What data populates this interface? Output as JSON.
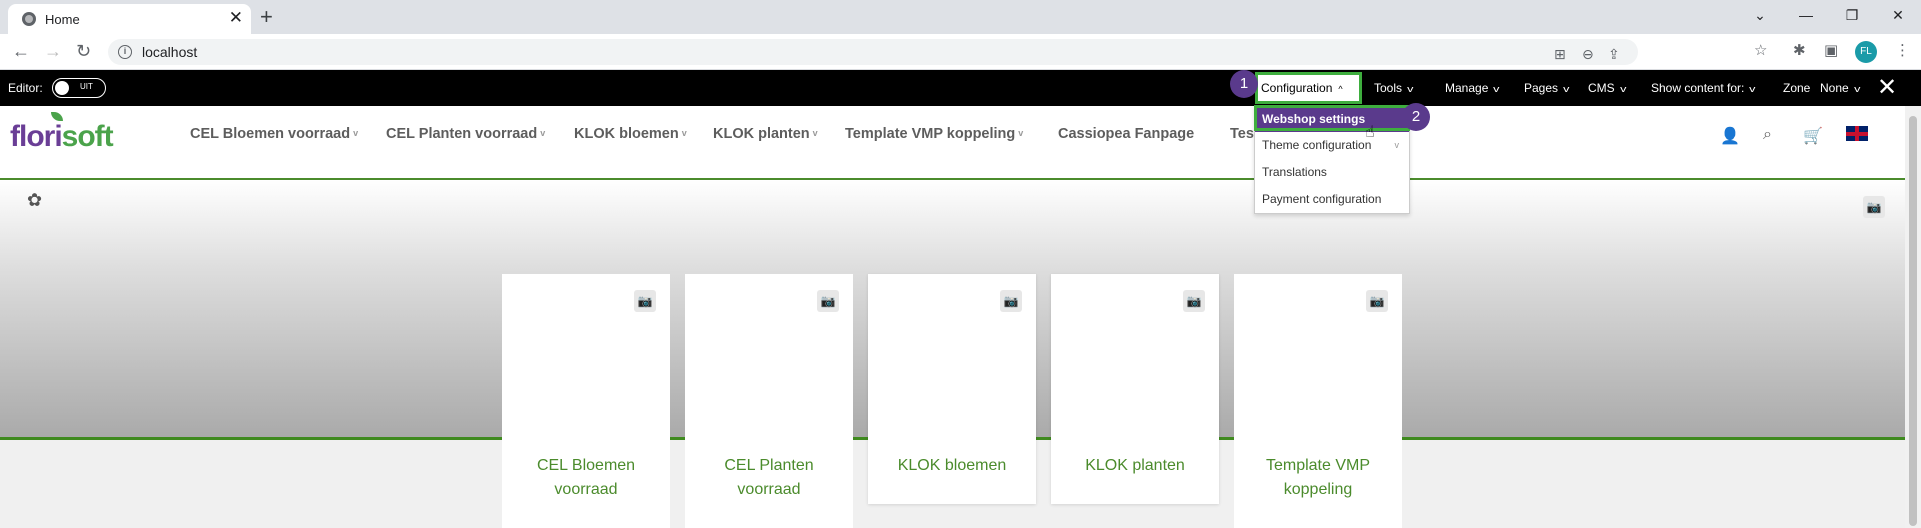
{
  "browser": {
    "tab_title": "Home",
    "tab_close": "✕",
    "new_tab": "+",
    "url": "localhost",
    "profile_initials": "FL",
    "window_controls": [
      "⌄",
      "—",
      "❐",
      "✕"
    ]
  },
  "editor_bar": {
    "editor_label": "Editor:",
    "toggle_state": "UIT",
    "menu": {
      "configuration": "Configuration",
      "tools": "Tools",
      "manage": "Manage",
      "pages": "Pages",
      "cms": "CMS",
      "show_content_for": "Show content for:",
      "zone_label": "Zone",
      "zone_value": "None"
    },
    "close": "✕"
  },
  "site": {
    "logo": {
      "part1": "flori",
      "part2": "soft"
    },
    "nav": [
      "CEL Bloemen voorraad",
      "CEL Planten voorraad",
      "KLOK bloemen",
      "KLOK planten",
      "Template VMP koppeling",
      "Cassiopea Fanpage",
      "Tes"
    ]
  },
  "dropdown": {
    "items": [
      "Webshop settings",
      "Theme configuration",
      "Translations",
      "Payment configuration"
    ],
    "active_index": 0
  },
  "markers": [
    "1",
    "2"
  ],
  "cards": [
    {
      "title_line1": "CEL Bloemen",
      "title_line2": "voorraad"
    },
    {
      "title_line1": "CEL Planten",
      "title_line2": "voorraad"
    },
    {
      "title_line1": "KLOK bloemen",
      "title_line2": ""
    },
    {
      "title_line1": "KLOK planten",
      "title_line2": ""
    },
    {
      "title_line1": "Template VMP",
      "title_line2": "koppeling"
    }
  ],
  "colors": {
    "brand_purple": "#5a3a8c",
    "brand_green": "#4b8b2c",
    "highlight_green": "#3eae3e",
    "editor_bar": "#000000"
  }
}
